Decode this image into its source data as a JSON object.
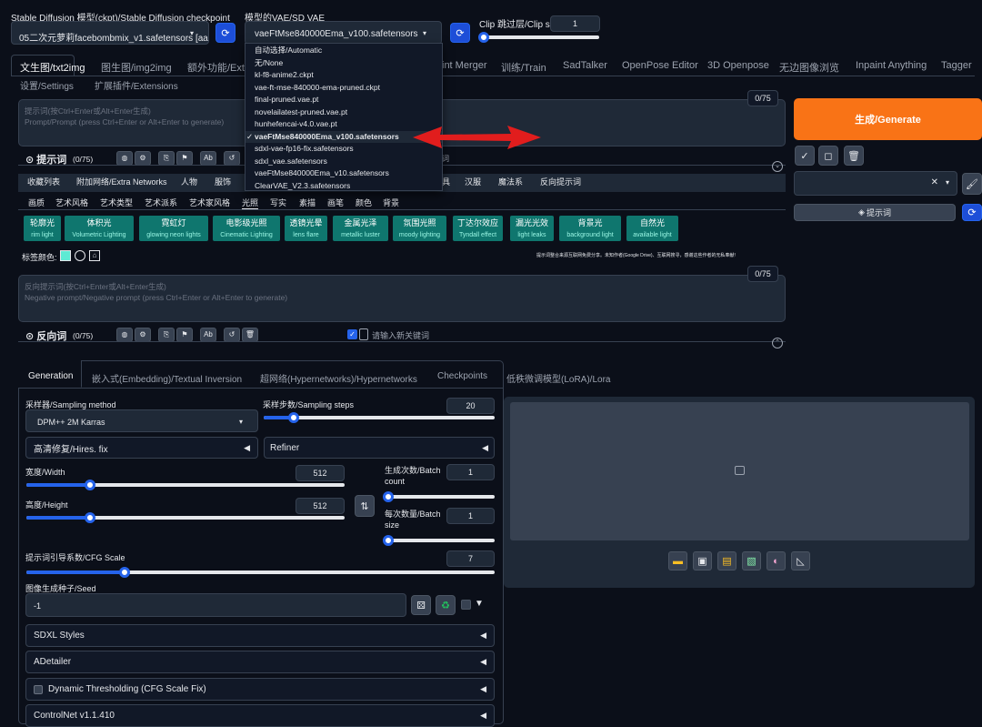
{
  "top": {
    "ckpt_label": "Stable Diffusion 模型(ckpt)/Stable Diffusion checkpoint",
    "ckpt_value": "05二次元萝莉facebombmix_v1.safetensors [aa",
    "vae_label": "模型的VAE/SD VAE",
    "vae_value": "vaeFtMse840000Ema_v100.safetensors",
    "clip_label": "Clip 跳过层/Clip skip",
    "clip_value": "1"
  },
  "vae_options": [
    "自动选择/Automatic",
    "无/None",
    "kl-f8-anime2.ckpt",
    "vae-ft-mse-840000-ema-pruned.ckpt",
    "final-pruned.vae.pt",
    "novelailatest-pruned.vae.pt",
    "hunhefencai-v4.0.vae.pt",
    "vaeFtMse840000Ema_v100.safetensors",
    "sdxl-vae-fp16-fix.safetensors",
    "sdxl_vae.safetensors",
    "vaeFtMse840000Ema_v10.safetensors",
    "ClearVAE_V2.3.safetensors"
  ],
  "vae_checkmark": "✓",
  "main_tabs": [
    "文生图/txt2img",
    "图生图/img2img",
    "额外功能/Extra",
    "int Merger",
    "训练/Train",
    "SadTalker",
    "OpenPose Editor",
    "3D Openpose",
    "无边图像浏览",
    "Inpaint Anything",
    "Tagger"
  ],
  "main_tabs_row2": [
    "设置/Settings",
    "扩展插件/Extensions"
  ],
  "prompt": {
    "counter": "0/75",
    "placeholder_line1": "提示词(按Ctrl+Enter或Alt+Enter生成)",
    "placeholder_line2": "Prompt/Prompt (press Ctrl+Enter or Alt+Enter to generate)",
    "toolbar_label": "提示词",
    "toolbar_count": "(0/75)",
    "keyword_placeholder": "请输入新关键词"
  },
  "generate_label": "生成/Generate",
  "style_tabs": [
    "收藏列表",
    "附加网络/Extra Networks",
    "人物",
    "服饰"
  ],
  "style_tabs_right": [
    "汉服",
    "魔法系",
    "反向提示词"
  ],
  "style_tab_partial": "具",
  "cat_tabs": [
    "画质",
    "艺术风格",
    "艺术类型",
    "艺术派系",
    "艺术家风格",
    "光照",
    "写实",
    "素描",
    "画笔",
    "颜色",
    "背景"
  ],
  "chips": [
    {
      "zh": "轮廓光",
      "en": "rim light"
    },
    {
      "zh": "体积光",
      "en": "Volumetric Lighting"
    },
    {
      "zh": "霓虹灯",
      "en": "glowing neon lights"
    },
    {
      "zh": "电影级光照",
      "en": "Cinematic Lighting"
    },
    {
      "zh": "透镜光晕",
      "en": "lens flare"
    },
    {
      "zh": "金属光泽",
      "en": "metallic luster"
    },
    {
      "zh": "氛围光照",
      "en": "moody lighting"
    },
    {
      "zh": "丁达尔效应",
      "en": "Tyndall effect"
    },
    {
      "zh": "漏光光效",
      "en": "light leaks"
    },
    {
      "zh": "背景光",
      "en": "background light"
    },
    {
      "zh": "自然光",
      "en": "available light"
    }
  ],
  "tag_color_label": "标签颜色:",
  "disclaimer": "提示词整合来源互联网免费分享。未知作者(Google Drive)、互联网搜寻，感谢这些作者的无私奉献!",
  "neg": {
    "counter": "0/75",
    "placeholder_line1": "反向提示词(按Ctrl+Enter或Alt+Enter生成)",
    "placeholder_line2": "Negative prompt/Negative prompt (press Ctrl+Enter or Alt+Enter to generate)",
    "toolbar_label": "反向词",
    "toolbar_count": "(0/75)",
    "keyword_placeholder": "请输入新关键词"
  },
  "right_prompt_btn": "提示词",
  "gen_tabs": [
    "Generation",
    "嵌入式(Embedding)/Textual Inversion",
    "超网络(Hypernetworks)/Hypernetworks",
    "Checkpoints",
    "低秩微调模型(LoRA)/Lora"
  ],
  "sampler": {
    "label": "采样器/Sampling method",
    "value": "DPM++ 2M Karras"
  },
  "steps": {
    "label": "采样步数/Sampling steps",
    "value": "20",
    "fraction": 0.13
  },
  "hires_label": "高清修复/Hires. fix",
  "refiner_label": "Refiner",
  "width": {
    "label": "宽度/Width",
    "value": "512",
    "fraction": 0.2
  },
  "height": {
    "label": "高度/Height",
    "value": "512",
    "fraction": 0.2
  },
  "batch_count": {
    "label": "生成次数/Batch count",
    "value": "1",
    "fraction": 0.0
  },
  "batch_size": {
    "label": "每次数量/Batch size",
    "value": "1",
    "fraction": 0.0
  },
  "cfg": {
    "label": "提示词引导系数/CFG Scale",
    "value": "7",
    "fraction": 0.21
  },
  "seed": {
    "label": "图像生成种子/Seed",
    "value": "-1"
  },
  "accordions": [
    "SDXL Styles",
    "ADetailer",
    "Dynamic Thresholding (CFG Scale Fix)",
    "ControlNet v1.1.410"
  ],
  "colors": {
    "accent": "#2563eb",
    "generate": "#f97316",
    "chip": "#0f766e",
    "arrow": "#e11d1d"
  }
}
